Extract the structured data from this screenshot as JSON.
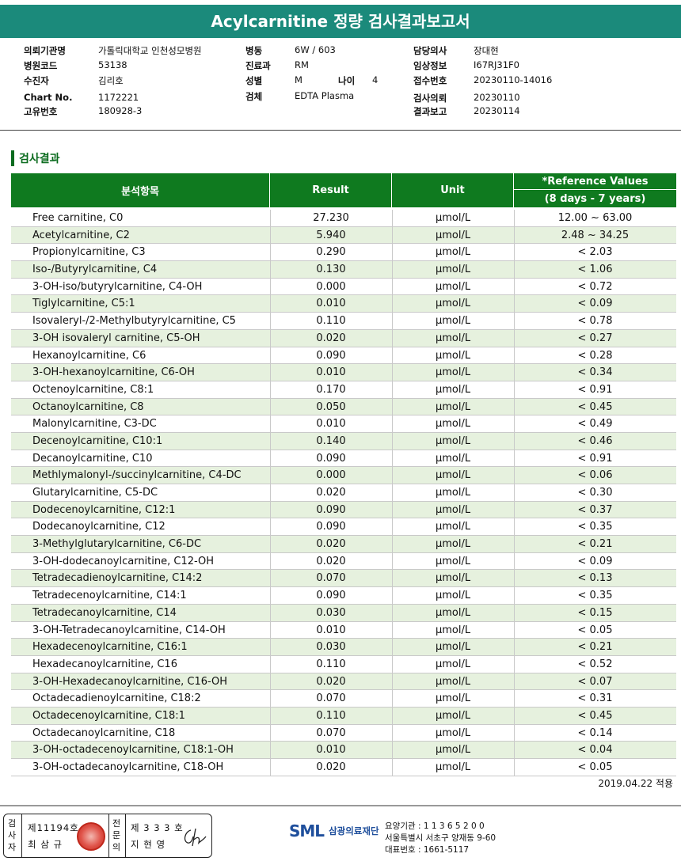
{
  "report_title": "Acylcarnitine 정량 검사결과보고서",
  "info": {
    "institution": {
      "label": "의뢰기관명",
      "value": "가톨릭대학교 인천성모병원"
    },
    "hospital_code": {
      "label": "병원코드",
      "value": "53138"
    },
    "patient": {
      "label": "수진자",
      "value": "김리호"
    },
    "chart_no": {
      "label": "Chart No.",
      "value": "1172221"
    },
    "unique_no": {
      "label": "고유번호",
      "value": "180928-3"
    },
    "ward": {
      "label": "병동",
      "value": "6W / 603"
    },
    "department": {
      "label": "진료과",
      "value": "RM"
    },
    "sex": {
      "label": "성별",
      "value": "M"
    },
    "age": {
      "label": "나이",
      "value": "4"
    },
    "specimen": {
      "label": "검체",
      "value": "EDTA Plasma"
    },
    "doctor": {
      "label": "담당의사",
      "value": "장대현"
    },
    "clinical_info": {
      "label": "임상정보",
      "value": "I67RJ31F0"
    },
    "receipt_no": {
      "label": "접수번호",
      "value": "20230110-14016"
    },
    "request_date": {
      "label": "검사의뢰",
      "value": "20230110"
    },
    "report_date": {
      "label": "결과보고",
      "value": "20230114"
    }
  },
  "section_title": "검사결과",
  "table": {
    "headers": {
      "item": "분석항목",
      "result": "Result",
      "unit": "Unit",
      "reference": "*Reference Values",
      "reference_range": "(8 days - 7 years)"
    },
    "rows": [
      {
        "name": "Free carnitine, C0",
        "result": "27.230",
        "unit": "μmol/L",
        "ref": "12.00 ~ 63.00"
      },
      {
        "name": "Acetylcarnitine, C2",
        "result": "5.940",
        "unit": "μmol/L",
        "ref": "2.48 ~ 34.25"
      },
      {
        "name": "Propionylcarnitine, C3",
        "result": "0.290",
        "unit": "μmol/L",
        "ref": "< 2.03"
      },
      {
        "name": "Iso-/Butyrylcarnitine, C4",
        "result": "0.130",
        "unit": "μmol/L",
        "ref": "< 1.06"
      },
      {
        "name": "3-OH-iso/butyrylcarnitine, C4-OH",
        "result": "0.000",
        "unit": "μmol/L",
        "ref": "< 0.72"
      },
      {
        "name": "Tiglylcarnitine, C5:1",
        "result": "0.010",
        "unit": "μmol/L",
        "ref": "< 0.09"
      },
      {
        "name": "Isovaleryl-/2-Methylbutyrylcarnitine, C5",
        "result": "0.110",
        "unit": "μmol/L",
        "ref": "< 0.78"
      },
      {
        "name": "3-OH isovaleryl carnitine, C5-OH",
        "result": "0.020",
        "unit": "μmol/L",
        "ref": "< 0.27"
      },
      {
        "name": "Hexanoylcarnitine, C6",
        "result": "0.090",
        "unit": "μmol/L",
        "ref": "< 0.28"
      },
      {
        "name": "3-OH-hexanoylcarnitine, C6-OH",
        "result": "0.010",
        "unit": "μmol/L",
        "ref": "< 0.34"
      },
      {
        "name": "Octenoylcarnitine, C8:1",
        "result": "0.170",
        "unit": "μmol/L",
        "ref": "< 0.91"
      },
      {
        "name": "Octanoylcarnitine, C8",
        "result": "0.050",
        "unit": "μmol/L",
        "ref": "< 0.45"
      },
      {
        "name": "Malonylcarnitine, C3-DC",
        "result": "0.010",
        "unit": "μmol/L",
        "ref": "< 0.49"
      },
      {
        "name": "Decenoylcarnitine, C10:1",
        "result": "0.140",
        "unit": "μmol/L",
        "ref": "< 0.46"
      },
      {
        "name": "Decanoylcarnitine, C10",
        "result": "0.090",
        "unit": "μmol/L",
        "ref": "< 0.91"
      },
      {
        "name": "Methlymalonyl-/succinylcarnitine, C4-DC",
        "result": "0.000",
        "unit": "μmol/L",
        "ref": "< 0.06"
      },
      {
        "name": "Glutarylcarnitine, C5-DC",
        "result": "0.020",
        "unit": "μmol/L",
        "ref": "< 0.30"
      },
      {
        "name": "Dodecenoylcarnitine, C12:1",
        "result": "0.090",
        "unit": "μmol/L",
        "ref": "< 0.37"
      },
      {
        "name": "Dodecanoylcarnitine, C12",
        "result": "0.090",
        "unit": "μmol/L",
        "ref": "< 0.35"
      },
      {
        "name": "3-Methylglutarylcarnitine, C6-DC",
        "result": "0.020",
        "unit": "μmol/L",
        "ref": "< 0.21"
      },
      {
        "name": "3-OH-dodecanoylcarnitine, C12-OH",
        "result": "0.020",
        "unit": "μmol/L",
        "ref": "< 0.09"
      },
      {
        "name": "Tetradecadienoylcarnitine, C14:2",
        "result": "0.070",
        "unit": "μmol/L",
        "ref": "< 0.13"
      },
      {
        "name": "Tetradecenoylcarnitine, C14:1",
        "result": "0.090",
        "unit": "μmol/L",
        "ref": "< 0.35"
      },
      {
        "name": "Tetradecanoylcarnitine, C14",
        "result": "0.030",
        "unit": "μmol/L",
        "ref": "< 0.15"
      },
      {
        "name": "3-OH-Tetradecanoylcarnitine, C14-OH",
        "result": "0.010",
        "unit": "μmol/L",
        "ref": "< 0.05"
      },
      {
        "name": "Hexadecenoylcarnitine, C16:1",
        "result": "0.030",
        "unit": "μmol/L",
        "ref": "< 0.21"
      },
      {
        "name": "Hexadecanoylcarnitine, C16",
        "result": "0.110",
        "unit": "μmol/L",
        "ref": "< 0.52"
      },
      {
        "name": "3-OH-Hexadecanoylcarnitine, C16-OH",
        "result": "0.020",
        "unit": "μmol/L",
        "ref": "< 0.07"
      },
      {
        "name": "Octadecadienoylcarnitine, C18:2",
        "result": "0.070",
        "unit": "μmol/L",
        "ref": "< 0.31"
      },
      {
        "name": "Octadecenoylcarnitine, C18:1",
        "result": "0.110",
        "unit": "μmol/L",
        "ref": "< 0.45"
      },
      {
        "name": "Octadecanoylcarnitine, C18",
        "result": "0.070",
        "unit": "μmol/L",
        "ref": "< 0.14"
      },
      {
        "name": "3-OH-octadecenoylcarnitine, C18:1-OH",
        "result": "0.010",
        "unit": "μmol/L",
        "ref": "< 0.04"
      },
      {
        "name": "3-OH-octadecanoylcarnitine, C18-OH",
        "result": "0.020",
        "unit": "μmol/L",
        "ref": "< 0.05"
      }
    ]
  },
  "note": "2019.04.22 적용",
  "signatures": {
    "tester_label": "검사자",
    "tester_no": "제11194호",
    "tester_name": "최 삼 규",
    "specialist_label": "전문의",
    "specialist_no": "제 3 3 3 호",
    "specialist_name": "지 현 영"
  },
  "footer": {
    "logo": "SML",
    "org_name": "삼광의료재단",
    "care_institution": "요양기관 : 1 1 3 6 5 2 0 0",
    "address": "서울특별시 서초구 양재동 9-60",
    "phone": "대표번호 : 1661-5117"
  }
}
